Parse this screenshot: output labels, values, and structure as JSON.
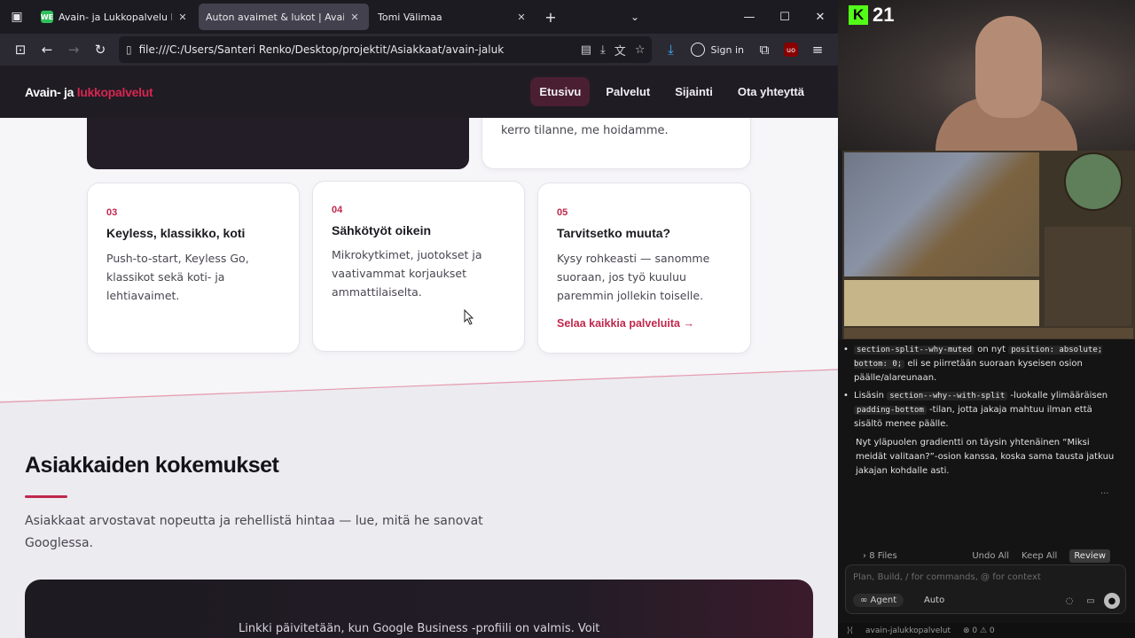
{
  "browser": {
    "tabs": [
      {
        "favicon": "WE",
        "label": "Avain- ja Lukkopalvelu Laune O",
        "active": false
      },
      {
        "favicon": "",
        "label": "Auton avaimet & lukot | Avain- ja lu",
        "active": true
      },
      {
        "favicon": "",
        "label": "Tomi Välimaa",
        "active": false
      }
    ],
    "url": "file:///C:/Users/Santeri Renko/Desktop/projektit/Asiakkaat/avain-jaluk",
    "sign_in_label": "Sign in",
    "window_controls": [
      "—",
      "☐",
      "✕"
    ]
  },
  "site": {
    "logo_main": "Avain- ja ",
    "logo_accent": "lukkopalvelut",
    "nav": [
      {
        "label": "Etusivu",
        "active": true
      },
      {
        "label": "Palvelut",
        "active": false
      },
      {
        "label": "Sijainti",
        "active": false
      },
      {
        "label": "Ota yhteyttä",
        "active": false
      }
    ],
    "top_card_text": "kerro tilanne, me hoidamme.",
    "cards": [
      {
        "num": "03",
        "title": "Keyless, klassikko, koti",
        "desc": "Push-to-start, Keyless Go, klassikot sekä koti- ja lehtiavaimet."
      },
      {
        "num": "04",
        "title": "Sähkötyöt oikein",
        "desc": "Mikrokytkimet, juotokset ja vaativammat korjaukset ammattilaiselta."
      },
      {
        "num": "05",
        "title": "Tarvitsetko muuta?",
        "desc": "Kysy rohkeasti — sanomme suoraan, jos työ kuuluu paremmin jollekin toiselle.",
        "link": "Selaa kaikkia palveluita →"
      }
    ],
    "reviews": {
      "title": "Asiakkaiden kokemukset",
      "lead": "Asiakkaat arvostavat nopeutta ja rehellistä hintaa — lue, mitä he sanovat Googlessa.",
      "box_text": "Linkki päivitetään, kun Google Business -profiili on valmis. Voit"
    }
  },
  "stream": {
    "kick_number": "21"
  },
  "chat": {
    "bullet1": {
      "code1": "section-split--why-muted",
      "t1": " on nyt ",
      "code2": "position: absolute; bottom: 0;",
      "t2": " eli se piirretään suoraan kyseisen osion päälle/alareunaan."
    },
    "bullet2": {
      "t0": "Lisäsin ",
      "code1": "section--why--with-split",
      "t1": " -luokalle ylimääräisen ",
      "code2": "padding-bottom",
      "t2": " -tilan, jotta jakaja mahtuu ilman että sisältö menee päälle."
    },
    "paragraph": "Nyt yläpuolen gradientti on täysin yhtenäinen “Miksi meidät valitaan?”-osion kanssa, koska sama tausta jatkuu jakajan kohdalle asti.",
    "dots": "...",
    "files_label": "8 Files",
    "undo_all": "Undo All",
    "keep_all": "Keep All",
    "review": "Review",
    "input_placeholder": "Plan, Build, / for commands, @ for context",
    "agent_label": "∞ Agent",
    "auto_label": "Auto",
    "status_project": "avain-jalukkopalvelut",
    "status_counts": "⊗ 0 ⚠ 0"
  },
  "colors": {
    "accent": "#c0284c",
    "header_bg": "#1f1c24",
    "page_bg": "#f6f5f8"
  }
}
